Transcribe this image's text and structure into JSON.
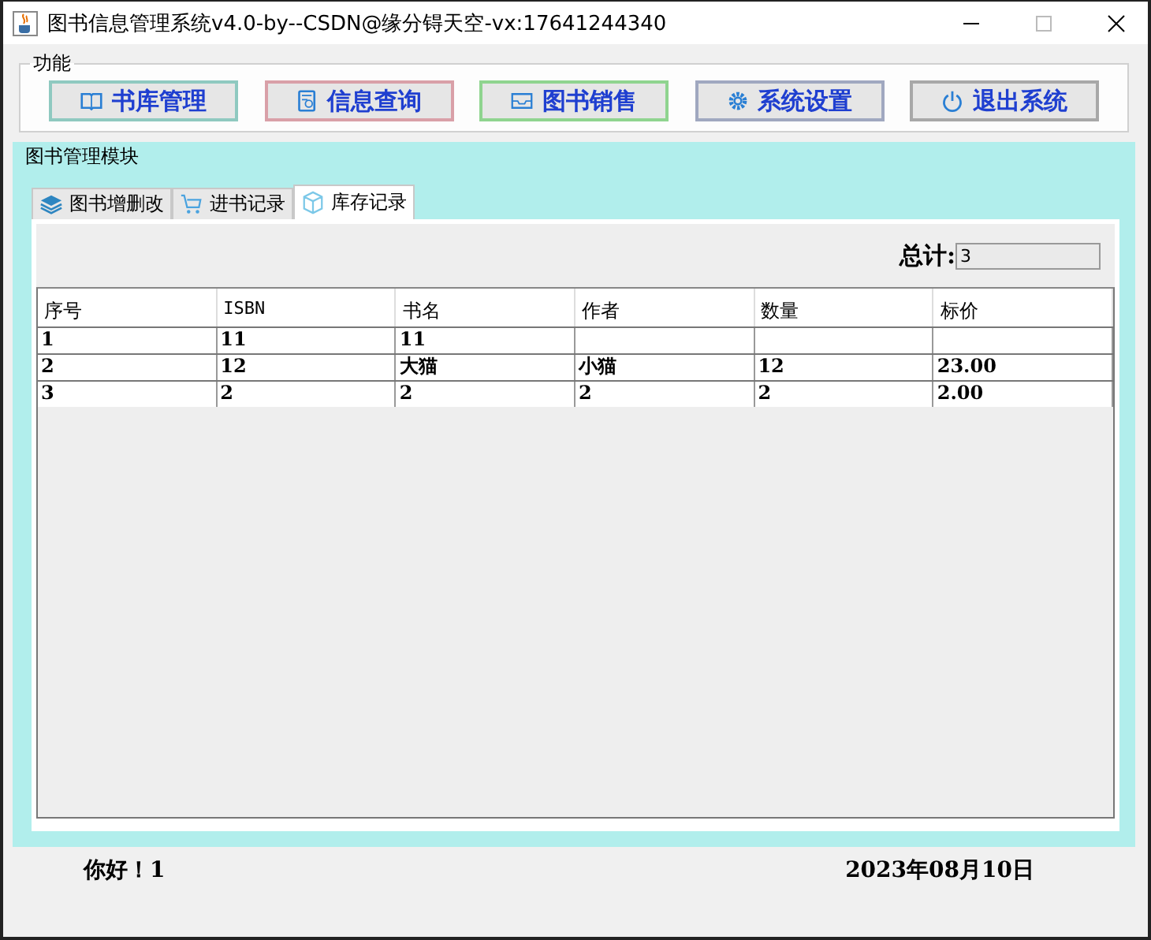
{
  "window": {
    "title": "图书信息管理系统v4.0-by--CSDN@缘分锝天空-vx:17641244340"
  },
  "function_group": {
    "title": "功能",
    "buttons": [
      {
        "label": "书库管理",
        "color": "#8fc9c0"
      },
      {
        "label": "信息查询",
        "color": "#d9a0a8"
      },
      {
        "label": "图书销售",
        "color": "#8fd48f"
      },
      {
        "label": "系统设置",
        "color": "#a0a8c0"
      },
      {
        "label": "退出系统",
        "color": "#a8a8a8"
      }
    ]
  },
  "module": {
    "title": "图书管理模块",
    "tabs": [
      {
        "label": "图书增删改",
        "selected": false
      },
      {
        "label": "进书记录",
        "selected": false
      },
      {
        "label": "库存记录",
        "selected": true
      }
    ]
  },
  "total": {
    "label": "总计:",
    "value": "3"
  },
  "table": {
    "columns": [
      "序号",
      "ISBN",
      "书名",
      "作者",
      "数量",
      "标价"
    ],
    "rows": [
      [
        "1",
        "11",
        "11",
        null,
        null,
        null
      ],
      [
        "2",
        "12",
        "大猫",
        "小猫",
        "12",
        "23.00"
      ],
      [
        "3",
        "2",
        "2",
        "2",
        "2",
        "2.00"
      ]
    ]
  },
  "status_bar": {
    "greeting": "你好！1",
    "date": "2023年08月10日"
  }
}
